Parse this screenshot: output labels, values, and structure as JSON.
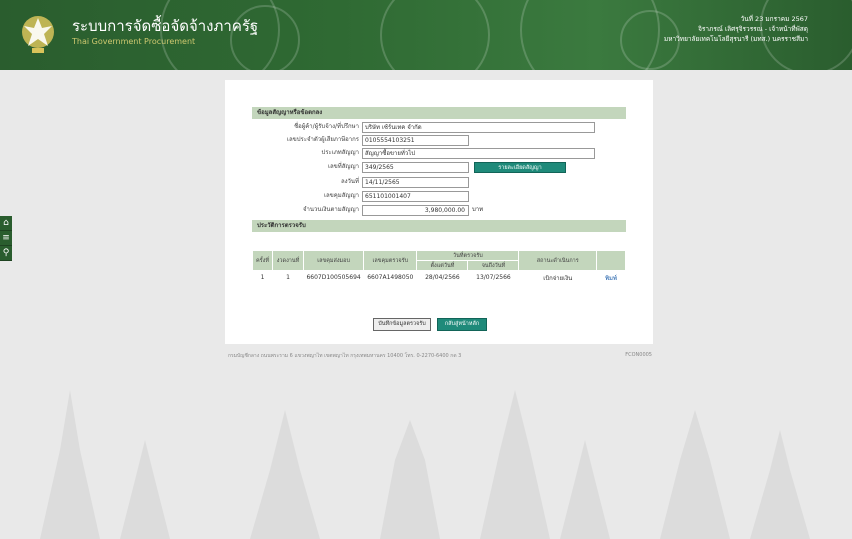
{
  "header": {
    "title": "ระบบการจัดซื้อจัดจ้างภาครัฐ",
    "subtitle": "Thai Government Procurement",
    "date": "วันที่ 23 มกราคม 2567",
    "user": "จิราภรณ์ เลิศรุจิรวรรณ - เจ้าหน้าที่พัสดุ",
    "org": "มหาวิทยาลัยเทคโนโลยีสุรนารี (มทส.) นครราชสีมา"
  },
  "sidebar": {
    "icons": [
      "home-icon",
      "menu-icon",
      "search-icon"
    ]
  },
  "form": {
    "section_title": "ข้อมูลสัญญาหรือข้อตกลง",
    "fields": [
      {
        "label": "ชื่อผู้ค้า/ผู้รับจ้าง/ที่ปรึกษา",
        "value": "บริษัท เซ้ร์นเทค จำกัด"
      },
      {
        "label": "เลขประจำตัวผู้เสียภาษีอากร",
        "value": "0105554103251"
      },
      {
        "label": "ประเภทสัญญา",
        "value": "สัญญาซื้อขายทั่วไป"
      },
      {
        "label": "เลขที่สัญญา",
        "value": "349/2565"
      },
      {
        "label": "ลงวันที่",
        "value": "14/11/2565"
      },
      {
        "label": "เลขคุมสัญญา",
        "value": "651101001407"
      },
      {
        "label": "จำนวนเงินตามสัญญา",
        "value": "3,980,000.00"
      }
    ],
    "contract_button": "รายละเอียดสัญญา",
    "unit": "บาท"
  },
  "inspection": {
    "section_title": "ประวัติการตรวจรับ",
    "headers": {
      "index": "ครั้งที่",
      "installment": "งวดงานที่",
      "delivery_no": "เลขคุมส่งมอบ",
      "inspection_no": "เลขคุมตรวจรับ",
      "inspection_date": "วันที่ตรวจรับ",
      "start_date": "ตั้งแต่วันที่",
      "end_date": "จนถึงวันที่",
      "status": "สถานะดำเนินการ"
    },
    "rows": [
      {
        "index": "1",
        "installment": "1",
        "delivery_no": "6607D100505694",
        "inspection_no": "6607A1498050",
        "start_date": "28/04/2566",
        "end_date": "13/07/2566",
        "status": "เบิกจ่ายเงิน",
        "action": "พิมพ์"
      }
    ]
  },
  "actions": {
    "save_label": "บันทึกข้อมูลตรวจรับ",
    "back_label": "กลับสู่หน้าหลัก"
  },
  "footer": {
    "address": "กรมบัญชีกลาง ถนนพระราม 6 แขวงพญาไท เขตพญาไท กรุงเทพมหานคร 10400 โทร. 0-2270-6400 กด 3",
    "code": "FCON0005"
  },
  "colors": {
    "header_green": "#2f6a33",
    "section_green": "#c3d6bc",
    "button_teal": "#1f8a7a"
  }
}
